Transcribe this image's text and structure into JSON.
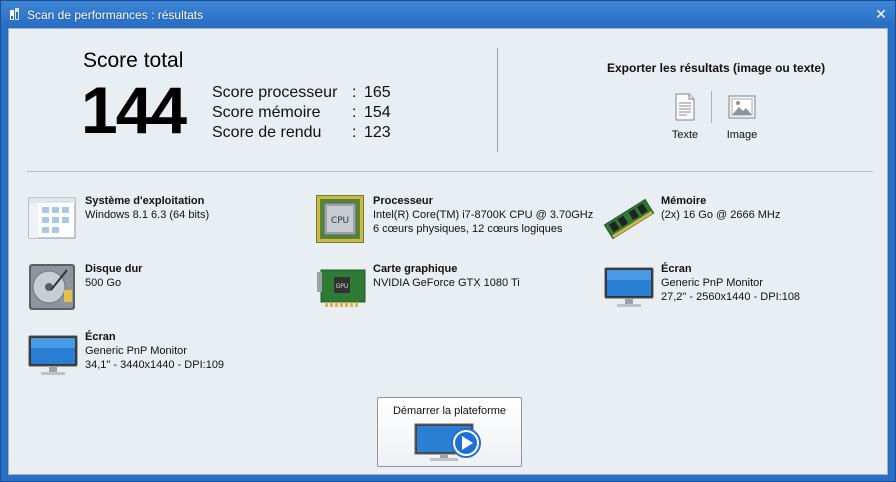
{
  "window": {
    "title": "Scan de performances : résultats"
  },
  "scores": {
    "total_label": "Score total",
    "total_value": "144",
    "items": [
      {
        "label": "Score processeur",
        "value": "165"
      },
      {
        "label": "Score mémoire",
        "value": "154"
      },
      {
        "label": "Score de rendu",
        "value": "123"
      }
    ]
  },
  "export": {
    "title": "Exporter les résultats (image ou texte)",
    "text_label": "Texte",
    "image_label": "Image"
  },
  "hardware": {
    "os": {
      "title": "Système d'exploitation",
      "line1": "Windows 8.1 6.3 (64 bits)",
      "icon": "windows-explorer-icon"
    },
    "cpu": {
      "title": "Processeur",
      "line1": "Intel(R) Core(TM) i7-8700K CPU @ 3.70GHz",
      "line2": "6 cœurs physiques, 12 cœurs logiques",
      "icon": "cpu-chip-icon"
    },
    "ram": {
      "title": "Mémoire",
      "line1": "(2x) 16 Go @ 2666 MHz",
      "icon": "ram-module-icon"
    },
    "disk": {
      "title": "Disque dur",
      "line1": "500 Go",
      "icon": "hard-disk-icon"
    },
    "gpu": {
      "title": "Carte graphique",
      "line1": "NVIDIA GeForce GTX 1080 Ti",
      "icon": "graphics-card-icon"
    },
    "screen1": {
      "title": "Écran",
      "line1": "Generic PnP Monitor",
      "line2": "27,2\" - 2560x1440 - DPI:108",
      "icon": "monitor-icon"
    },
    "screen2": {
      "title": "Écran",
      "line1": "Generic PnP Monitor",
      "line2": "34,1\" - 3440x1440 - DPI:109",
      "icon": "monitor-icon"
    }
  },
  "launch": {
    "label": "Démarrer la plateforme"
  },
  "colors": {
    "titlebar": "#2a6fc6",
    "client_bg": "#e9eef3",
    "accent_blue": "#1e6fd9"
  }
}
